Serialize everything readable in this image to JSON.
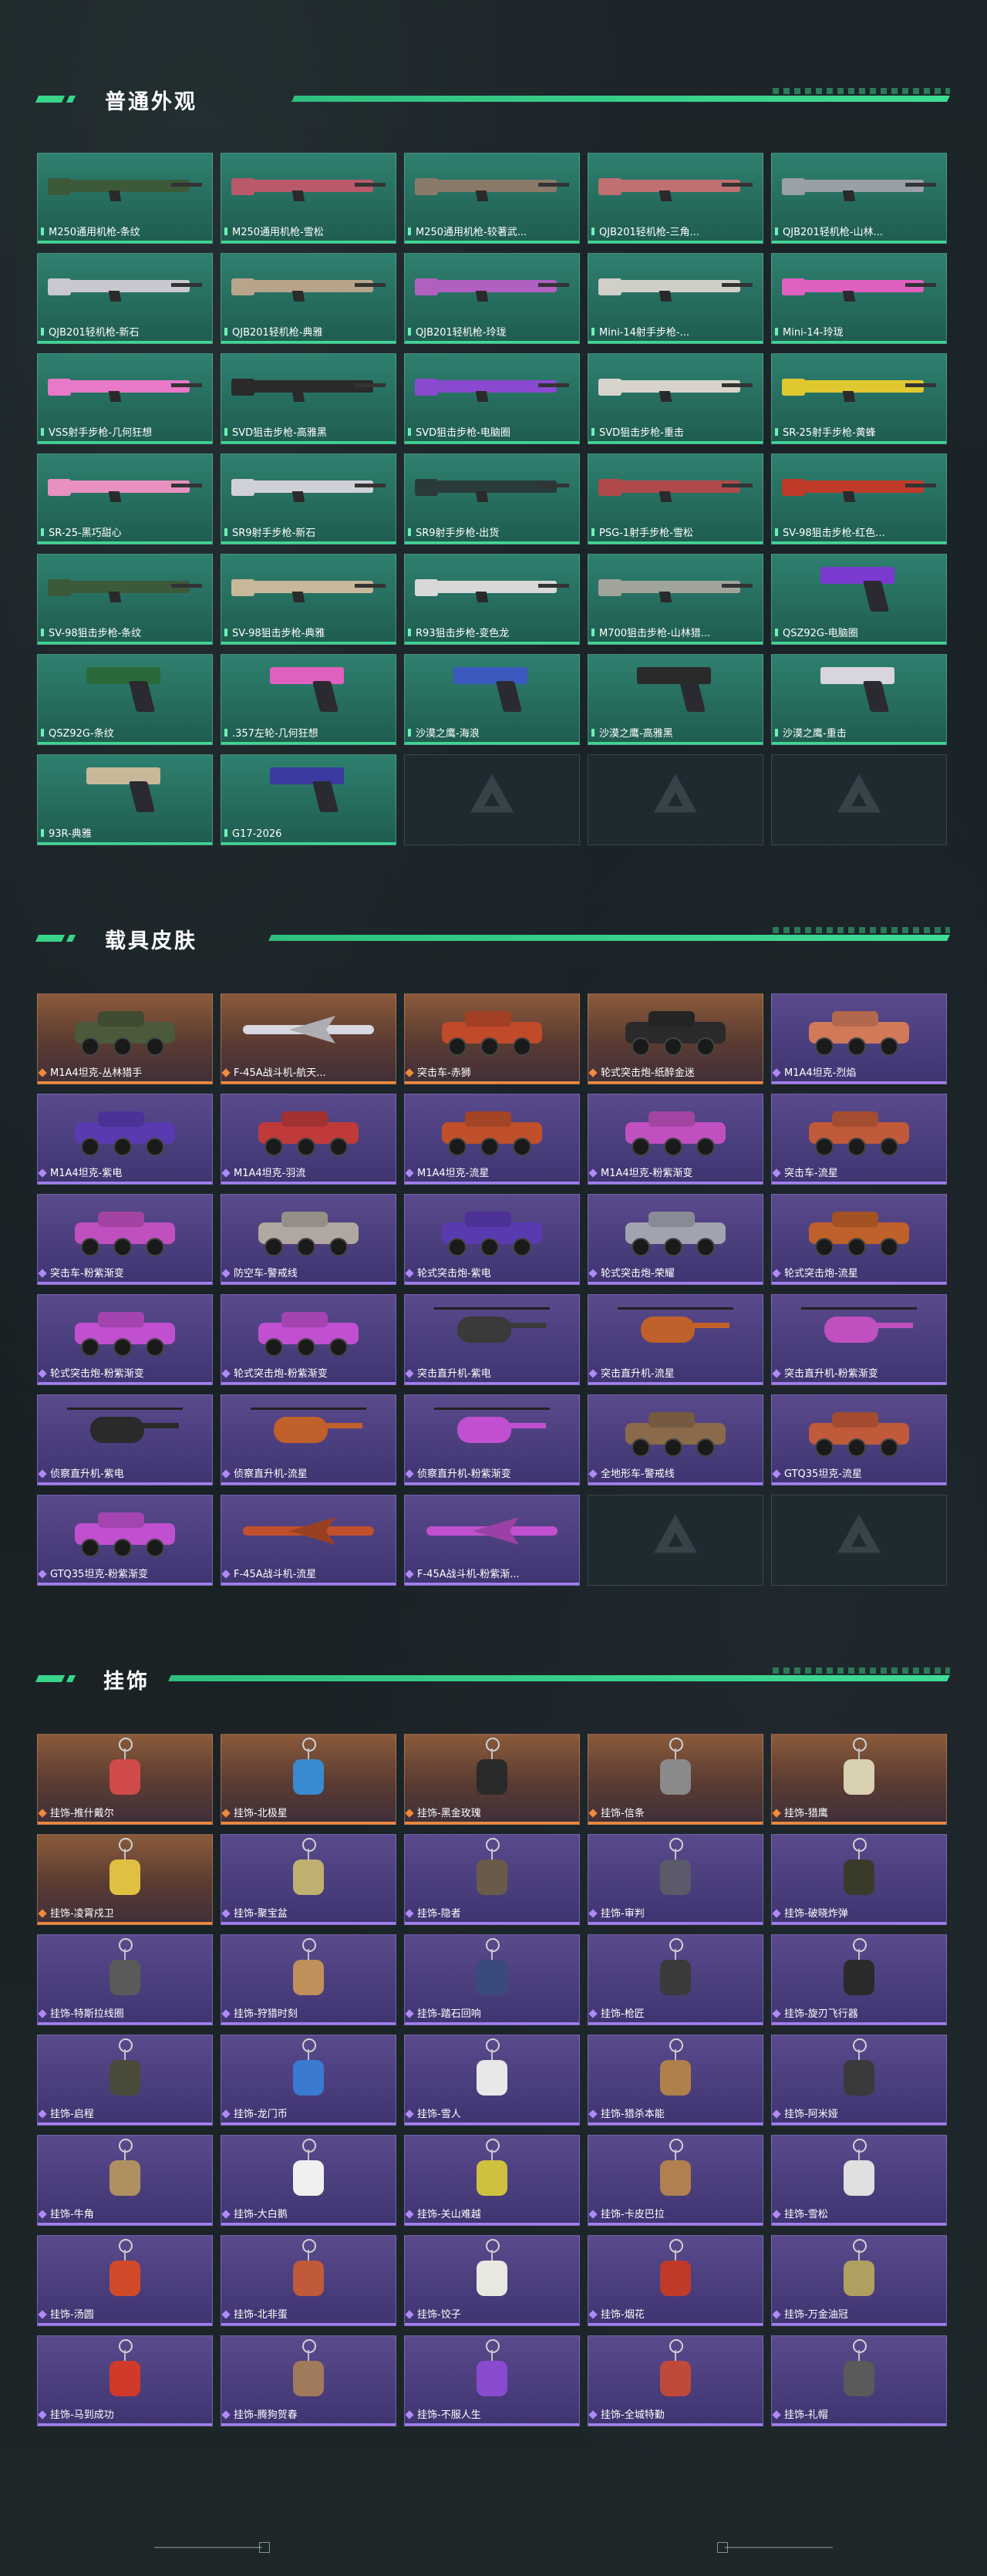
{
  "sections": [
    {
      "title": "普通外观",
      "theme": "green",
      "items": [
        {
          "label": "M250通用机枪-条纹",
          "kind": "gun",
          "color": "#3c5a3a"
        },
        {
          "label": "M250通用机枪-雪松",
          "kind": "gun",
          "color": "#b85a6a"
        },
        {
          "label": "M250通用机枪-较著武...",
          "kind": "gun",
          "color": "#8a7a6a"
        },
        {
          "label": "QJB201轻机枪-三角...",
          "kind": "gun",
          "color": "#c07070"
        },
        {
          "label": "QJB201轻机枪-山林...",
          "kind": "gun",
          "color": "#9aa0a8"
        },
        {
          "label": "QJB201轻机枪-新石",
          "kind": "gun",
          "color": "#c8c8d0"
        },
        {
          "label": "QJB201轻机枪-典雅",
          "kind": "gun",
          "color": "#b8a48a"
        },
        {
          "label": "QJB201轻机枪-玲珑",
          "kind": "gun",
          "color": "#b060c0"
        },
        {
          "label": "Mini-14射手步枪-...",
          "kind": "gun",
          "color": "#d0cfc8"
        },
        {
          "label": "Mini-14-玲珑",
          "kind": "gun",
          "color": "#e060c0"
        },
        {
          "label": "VSS射手步枪-几何狂想",
          "kind": "gun",
          "color": "#e878c8"
        },
        {
          "label": "SVD狙击步枪-高雅黑",
          "kind": "gun",
          "color": "#2a2a2a"
        },
        {
          "label": "SVD狙击步枪-电脑圈",
          "kind": "gun",
          "color": "#8a4ad0"
        },
        {
          "label": "SVD狙击步枪-重击",
          "kind": "gun",
          "color": "#d8d4cc"
        },
        {
          "label": "SR-25射手步枪-黄蜂",
          "kind": "gun",
          "color": "#e0c830"
        },
        {
          "label": "SR-25-黑巧甜心",
          "kind": "gun",
          "color": "#e890c0"
        },
        {
          "label": "SR9射手步枪-新石",
          "kind": "gun",
          "color": "#d0d0d8"
        },
        {
          "label": "SR9射手步枪-出货",
          "kind": "gun",
          "color": "#2a3a3a"
        },
        {
          "label": "PSG-1射手步枪-雪松",
          "kind": "gun",
          "color": "#b04a4a"
        },
        {
          "label": "SV-98狙击步枪-红色...",
          "kind": "gun",
          "color": "#c03a2a"
        },
        {
          "label": "SV-98狙击步枪-条纹",
          "kind": "gun",
          "color": "#3c5a3a"
        },
        {
          "label": "SV-98狙击步枪-典雅",
          "kind": "gun",
          "color": "#c8b89a"
        },
        {
          "label": "R93狙击步枪-变色龙",
          "kind": "gun",
          "color": "#d8d8d8"
        },
        {
          "label": "M700狙击步枪-山林猎...",
          "kind": "gun",
          "color": "#a0a49a"
        },
        {
          "label": "QSZ92G-电脑圈",
          "kind": "pistol",
          "color": "#7a3ad0"
        },
        {
          "label": "QSZ92G-条纹",
          "kind": "pistol",
          "color": "#2a6a3a"
        },
        {
          "label": ".357左轮-几何狂想",
          "kind": "pistol",
          "color": "#e060c0"
        },
        {
          "label": "沙漠之鹰-海浪",
          "kind": "pistol",
          "color": "#3a5ac0"
        },
        {
          "label": "沙漠之鹰-高雅黑",
          "kind": "pistol",
          "color": "#2a2a2a"
        },
        {
          "label": "沙漠之鹰-重击",
          "kind": "pistol",
          "color": "#d8d4e0"
        },
        {
          "label": "93R-典雅",
          "kind": "pistol",
          "color": "#c8b89a"
        },
        {
          "label": "G17-2026",
          "kind": "pistol",
          "color": "#3a3aa0"
        }
      ],
      "empty_slots": 3
    },
    {
      "title": "载具皮肤",
      "theme": "vehicle",
      "items": [
        {
          "label": "M1A4坦克-丛林猎手",
          "kind": "tank",
          "color": "#4a5a3a",
          "rarity": "orange"
        },
        {
          "label": "F-45A战斗机-航天...",
          "kind": "jet",
          "color": "#d8d8e0",
          "rarity": "orange"
        },
        {
          "label": "突击车-赤狮",
          "kind": "car",
          "color": "#c04a2a",
          "rarity": "orange"
        },
        {
          "label": "轮式突击炮-纸醉金迷",
          "kind": "car",
          "color": "#2a2a2a",
          "rarity": "orange"
        },
        {
          "label": "M1A4坦克-烈焰",
          "kind": "tank",
          "color": "#d07a5a",
          "rarity": "purple"
        },
        {
          "label": "M1A4坦克-紫电",
          "kind": "tank",
          "color": "#5a3ab0",
          "rarity": "purple"
        },
        {
          "label": "M1A4坦克-羽流",
          "kind": "tank",
          "color": "#c03a3a",
          "rarity": "purple"
        },
        {
          "label": "M1A4坦克-流星",
          "kind": "tank",
          "color": "#c0502a",
          "rarity": "purple"
        },
        {
          "label": "M1A4坦克-粉紫渐变",
          "kind": "tank",
          "color": "#c050c0",
          "rarity": "purple"
        },
        {
          "label": "突击车-流星",
          "kind": "car",
          "color": "#c05a3a",
          "rarity": "purple"
        },
        {
          "label": "突击车-粉紫渐变",
          "kind": "car",
          "color": "#c050c0",
          "rarity": "purple"
        },
        {
          "label": "防空车-警戒线",
          "kind": "car",
          "color": "#b0a8a0",
          "rarity": "purple"
        },
        {
          "label": "轮式突击炮-紫电",
          "kind": "car",
          "color": "#5a3ab0",
          "rarity": "purple"
        },
        {
          "label": "轮式突击炮-荣耀",
          "kind": "car",
          "color": "#a0a4b0",
          "rarity": "purple"
        },
        {
          "label": "轮式突击炮-流星",
          "kind": "car",
          "color": "#c0602a",
          "rarity": "purple"
        },
        {
          "label": "轮式突击炮-粉紫渐变",
          "kind": "car",
          "color": "#c050d0",
          "rarity": "purple"
        },
        {
          "label": "轮式突击炮-粉紫渐变",
          "kind": "car",
          "color": "#c050d0",
          "rarity": "purple"
        },
        {
          "label": "突击直升机-紫电",
          "kind": "heli",
          "color": "#3a3a3a",
          "rarity": "purple"
        },
        {
          "label": "突击直升机-流星",
          "kind": "heli",
          "color": "#c0602a",
          "rarity": "purple"
        },
        {
          "label": "突击直升机-粉紫渐变",
          "kind": "heli",
          "color": "#c050c0",
          "rarity": "purple"
        },
        {
          "label": "侦察直升机-紫电",
          "kind": "heli",
          "color": "#2a2a2a",
          "rarity": "purple"
        },
        {
          "label": "侦察直升机-流星",
          "kind": "heli",
          "color": "#c0602a",
          "rarity": "purple"
        },
        {
          "label": "侦察直升机-粉紫渐变",
          "kind": "heli",
          "color": "#c050d0",
          "rarity": "purple"
        },
        {
          "label": "全地形车-警戒线",
          "kind": "car",
          "color": "#8a6a4a",
          "rarity": "purple"
        },
        {
          "label": "GTQ35坦克-流星",
          "kind": "tank",
          "color": "#c05a3a",
          "rarity": "purple"
        },
        {
          "label": "GTQ35坦克-粉紫渐变",
          "kind": "tank",
          "color": "#c050d0",
          "rarity": "purple"
        },
        {
          "label": "F-45A战斗机-流星",
          "kind": "jet",
          "color": "#c0502a",
          "rarity": "purple"
        },
        {
          "label": "F-45A战斗机-粉紫渐...",
          "kind": "jet",
          "color": "#c050d0",
          "rarity": "purple"
        }
      ],
      "empty_slots": 2
    },
    {
      "title": "挂饰",
      "theme": "charm",
      "items": [
        {
          "label": "挂饰-推什戴尔",
          "kind": "charm",
          "color": "#d04a4a",
          "rarity": "orange"
        },
        {
          "label": "挂饰-北极星",
          "kind": "charm",
          "color": "#3a8ad0",
          "rarity": "orange"
        },
        {
          "label": "挂饰-黑金玫瑰",
          "kind": "charm",
          "color": "#2a2a2a",
          "rarity": "orange"
        },
        {
          "label": "挂饰-信条",
          "kind": "charm",
          "color": "#8a8a8a",
          "rarity": "orange"
        },
        {
          "label": "挂饰-猎鹰",
          "kind": "charm",
          "color": "#d8d0b0",
          "rarity": "orange"
        },
        {
          "label": "挂饰-凌霄戍卫",
          "kind": "charm",
          "color": "#e0c040",
          "rarity": "orange"
        },
        {
          "label": "挂饰-聚宝盆",
          "kind": "charm",
          "color": "#c0b070",
          "rarity": "purple"
        },
        {
          "label": "挂饰-隐者",
          "kind": "charm",
          "color": "#6a5a4a",
          "rarity": "purple"
        },
        {
          "label": "挂饰-审判",
          "kind": "charm",
          "color": "#5a5a6a",
          "rarity": "purple"
        },
        {
          "label": "挂饰-破晓炸弹",
          "kind": "charm",
          "color": "#3a3a2a",
          "rarity": "purple"
        },
        {
          "label": "挂饰-特斯拉线圈",
          "kind": "charm",
          "color": "#5a5a5a",
          "rarity": "purple"
        },
        {
          "label": "挂饰-狩猎时刻",
          "kind": "charm",
          "color": "#c0905a",
          "rarity": "purple"
        },
        {
          "label": "挂饰-踏石回响",
          "kind": "charm",
          "color": "#3a4a7a",
          "rarity": "purple"
        },
        {
          "label": "挂饰-枪匠",
          "kind": "charm",
          "color": "#3a3a3a",
          "rarity": "purple"
        },
        {
          "label": "挂饰-旋刃飞行器",
          "kind": "charm",
          "color": "#2a2a2a",
          "rarity": "purple"
        },
        {
          "label": "挂饰-启程",
          "kind": "charm",
          "color": "#4a4a3a",
          "rarity": "purple"
        },
        {
          "label": "挂饰-龙门币",
          "kind": "charm",
          "color": "#3a7ad0",
          "rarity": "purple"
        },
        {
          "label": "挂饰-雪人",
          "kind": "charm",
          "color": "#e8e8e8",
          "rarity": "purple"
        },
        {
          "label": "挂饰-猎杀本能",
          "kind": "charm",
          "color": "#b0804a",
          "rarity": "purple"
        },
        {
          "label": "挂饰-阿米娅",
          "kind": "charm",
          "color": "#3a3a3a",
          "rarity": "purple"
        },
        {
          "label": "挂饰-牛角",
          "kind": "charm",
          "color": "#b09060",
          "rarity": "purple"
        },
        {
          "label": "挂饰-大白鹅",
          "kind": "charm",
          "color": "#f0f0f0",
          "rarity": "purple"
        },
        {
          "label": "挂饰-关山难越",
          "kind": "charm",
          "color": "#d0c040",
          "rarity": "purple"
        },
        {
          "label": "挂饰-卡皮巴拉",
          "kind": "charm",
          "color": "#b08050",
          "rarity": "purple"
        },
        {
          "label": "挂饰-雪松",
          "kind": "charm",
          "color": "#e0e0e0",
          "rarity": "purple"
        },
        {
          "label": "挂饰-汤圆",
          "kind": "charm",
          "color": "#d04a2a",
          "rarity": "purple"
        },
        {
          "label": "挂饰-北非蛋",
          "kind": "charm",
          "color": "#c05a3a",
          "rarity": "purple"
        },
        {
          "label": "挂饰-饺子",
          "kind": "charm",
          "color": "#e8e8e0",
          "rarity": "purple"
        },
        {
          "label": "挂饰-烟花",
          "kind": "charm",
          "color": "#c03a2a",
          "rarity": "purple"
        },
        {
          "label": "挂饰-万金油冠",
          "kind": "charm",
          "color": "#b0a060",
          "rarity": "purple"
        },
        {
          "label": "挂饰-马到成功",
          "kind": "charm",
          "color": "#d03a2a",
          "rarity": "purple"
        },
        {
          "label": "挂饰-腾狗贺春",
          "kind": "charm",
          "color": "#a07a5a",
          "rarity": "purple"
        },
        {
          "label": "挂饰-不服人生",
          "kind": "charm",
          "color": "#8a4ad0",
          "rarity": "purple"
        },
        {
          "label": "挂饰-全城特勤",
          "kind": "charm",
          "color": "#c04a3a",
          "rarity": "purple"
        },
        {
          "label": "挂饰-礼帽",
          "kind": "charm",
          "color": "#5a5a5a",
          "rarity": "purple"
        }
      ],
      "empty_slots": 0
    }
  ]
}
